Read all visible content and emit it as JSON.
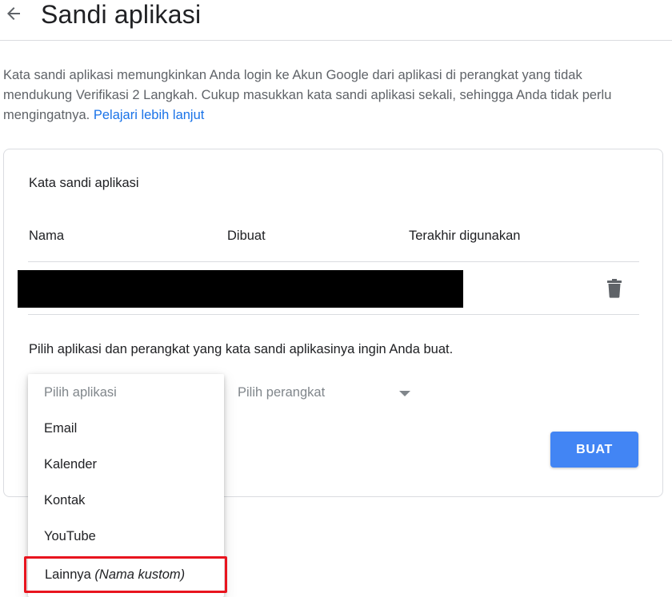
{
  "header": {
    "title": "Sandi aplikasi",
    "back_icon": "arrow-back-icon"
  },
  "description": {
    "text": "Kata sandi aplikasi memungkinkan Anda login ke Akun Google dari aplikasi di perangkat yang tidak mendukung Verifikasi 2 Langkah. Cukup masukkan kata sandi aplikasi sekali, sehingga Anda tidak perlu mengingatnya.",
    "link": "Pelajari lebih lanjut"
  },
  "card": {
    "title": "Kata sandi aplikasi",
    "columns": [
      "Nama",
      "Dibuat",
      "Terakhir digunakan"
    ],
    "row_delete_icon": "trash-icon",
    "instruction": "Pilih aplikasi dan perangkat yang kata sandi aplikasinya ingin Anda buat.",
    "device_select": {
      "placeholder": "Pilih perangkat",
      "icon": "dropdown-caret-icon"
    },
    "create_button": "BUAT"
  },
  "app_dropdown": {
    "placeholder": "Pilih aplikasi",
    "options": [
      "Email",
      "Kalender",
      "Kontak",
      "YouTube"
    ],
    "custom_option": {
      "label": "Lainnya",
      "hint": "(Nama kustom)"
    }
  },
  "colors": {
    "primary_blue": "#4285f4",
    "link_blue": "#1a73e8",
    "highlight_red": "#e8141e",
    "icon_gray": "#5f6368"
  }
}
